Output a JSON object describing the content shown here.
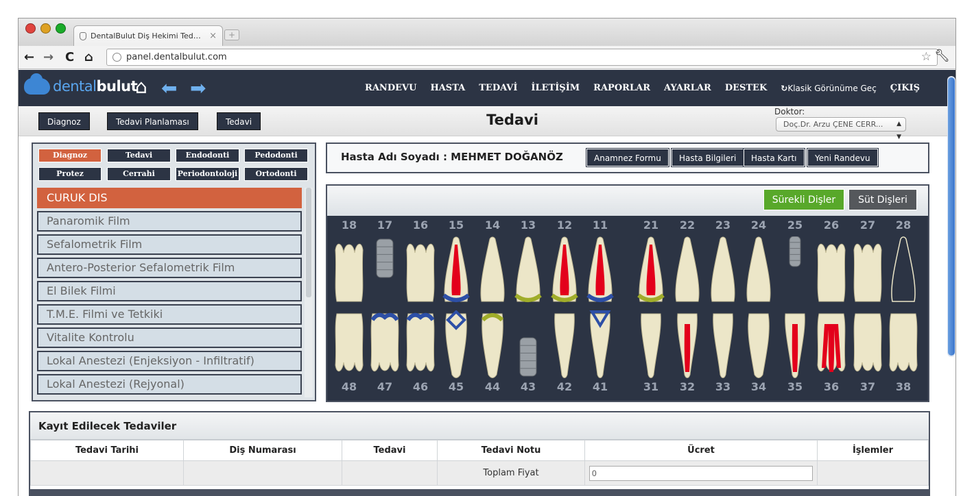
{
  "browser": {
    "tab_title": "DentalBulut Diş Hekimi Tedavi O",
    "tab_close": "×",
    "new_tab": "+",
    "url": "panel.dentalbulut.com"
  },
  "app": {
    "logo_part1": "dental",
    "logo_part2": "bulut",
    "menu": [
      "RANDEVU",
      "HASTA",
      "TEDAVİ",
      "İLETİŞİM",
      "RAPORLAR",
      "AYARLAR",
      "DESTEK"
    ],
    "classic_view": "Klasik Görünüme Geç",
    "exit": "ÇIKIŞ"
  },
  "subheader": {
    "buttons": [
      "Diagnoz",
      "Tedavi Planlaması",
      "Tedavi"
    ],
    "title": "Tedavi",
    "doctor_label": "Doktor:",
    "doctor_value": "Doç.Dr. Arzu ÇENE CERR..."
  },
  "categories": [
    "Diagnoz",
    "Tedavi",
    "Endodonti",
    "Pedodonti",
    "Protez",
    "Cerrahi",
    "Periodontoloji",
    "Ortodonti"
  ],
  "active_category": "Diagnoz",
  "procedures": [
    "CURUK DIS",
    "Panaromik Film",
    "Sefalometrik Film",
    "Antero-Posterior Sefalometrik Film",
    "El Bilek Filmi",
    "T.M.E. Filmi ve Tetkiki",
    "Vitalite Kontrolu",
    "Lokal Anestezi (Enjeksiyon - Infiltratif)",
    "Lokal Anestezi (Rejyonal)"
  ],
  "patient": {
    "label": "Hasta Adı Soyadı : MEHMET DOĞANÖZ",
    "buttons": [
      "Anamnez Formu",
      "Hasta Bilgileri",
      "Hasta Kartı",
      "Yeni Randevu"
    ]
  },
  "chart": {
    "permanent": "Sürekli Dişler",
    "milk": "Süt Dişleri",
    "upper": [
      "18",
      "17",
      "16",
      "15",
      "14",
      "13",
      "12",
      "11",
      "21",
      "22",
      "23",
      "24",
      "25",
      "26",
      "27",
      "28"
    ],
    "lower": [
      "48",
      "47",
      "46",
      "45",
      "44",
      "43",
      "42",
      "41",
      "31",
      "32",
      "33",
      "34",
      "35",
      "36",
      "37",
      "38"
    ],
    "colors": {
      "tooth": "#ece6c8",
      "root_canal": "#e3001b",
      "blue": "#2d4fa6",
      "green": "#a0ad2a",
      "implant": "#9aa0a6"
    }
  },
  "records": {
    "title": "Kayıt Edilecek Tedaviler",
    "headers": [
      "Tedavi Tarihi",
      "Diş Numarası",
      "Tedavi",
      "Tedavi Notu",
      "Ücret",
      "İşlemler"
    ],
    "total_label": "Toplam Fiyat",
    "total_value": "0"
  }
}
